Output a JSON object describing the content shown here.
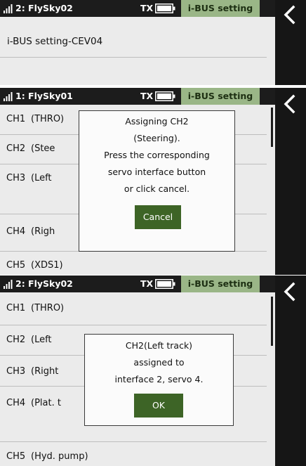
{
  "panel1": {
    "status": {
      "model": "2: FlySky02",
      "tx_label": "TX",
      "mode": "i-BUS setting"
    },
    "title": "i-BUS setting-CEV04"
  },
  "panel2": {
    "status": {
      "model": "1: FlySky01",
      "tx_label": "TX",
      "mode": "i-BUS setting"
    },
    "rows": [
      {
        "ch": "CH1",
        "name": "(THRO)"
      },
      {
        "ch": "CH2",
        "name": "(Stee"
      },
      {
        "ch": "CH3",
        "name": "(Left"
      },
      {
        "ch": "CH4",
        "name": "(Righ"
      },
      {
        "ch": "CH5",
        "name": "(XDS1)"
      }
    ],
    "dialog": {
      "lines": [
        "Assigning CH2",
        "(Steering).",
        "Press the corresponding",
        "servo interface button",
        "or click cancel."
      ],
      "button": "Cancel"
    }
  },
  "panel3": {
    "status": {
      "model": "2: FlySky02",
      "tx_label": "TX",
      "mode": "i-BUS setting"
    },
    "rows": [
      {
        "ch": "CH1",
        "name": "(THRO)"
      },
      {
        "ch": "CH2",
        "name": "(Left"
      },
      {
        "ch": "CH3",
        "name": "(Right"
      },
      {
        "ch": "CH4",
        "name": "(Plat. t"
      },
      {
        "ch": "CH5",
        "name": "(Hyd. pump)"
      }
    ],
    "dialog": {
      "lines": [
        "CH2(Left track)",
        "assigned to",
        "interface 2, servo 4."
      ],
      "button": "OK"
    }
  },
  "icons": {
    "signal": "signal-bars-icon",
    "battery": "battery-icon",
    "back": "back-chevron-icon"
  },
  "colors": {
    "status_bar": "#1c1c1c",
    "mode_tab": "#9ab687",
    "button_green": "#3d6426",
    "screen_bg": "#ebebeb"
  }
}
